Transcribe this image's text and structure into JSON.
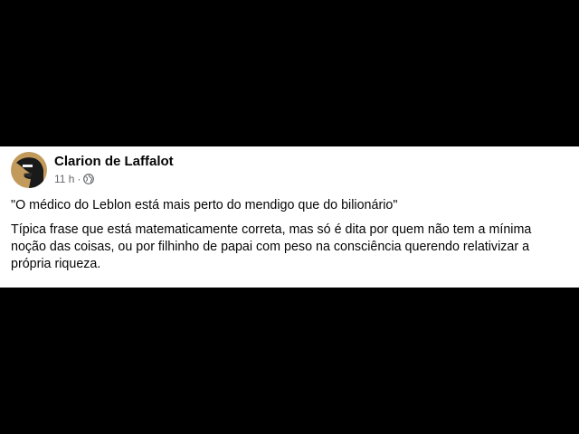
{
  "post": {
    "author_name": "Clarion de Laffalot",
    "timestamp": "11 h",
    "separator": "·",
    "privacy_icon": "globe-icon",
    "quote": "\"O médico do Leblon está mais perto do mendigo que do bilionário\"",
    "body": "Típica frase que está matematicamente correta, mas só é dita por quem não tem a mínima noção das coisas, ou por filhinho de papai com peso na consciência querendo relativizar a própria riqueza."
  },
  "colors": {
    "letterbox": "#000000",
    "card": "#ffffff",
    "author_text": "#050505",
    "meta_text": "#65676b",
    "avatar_bg": "#c29a5b"
  }
}
